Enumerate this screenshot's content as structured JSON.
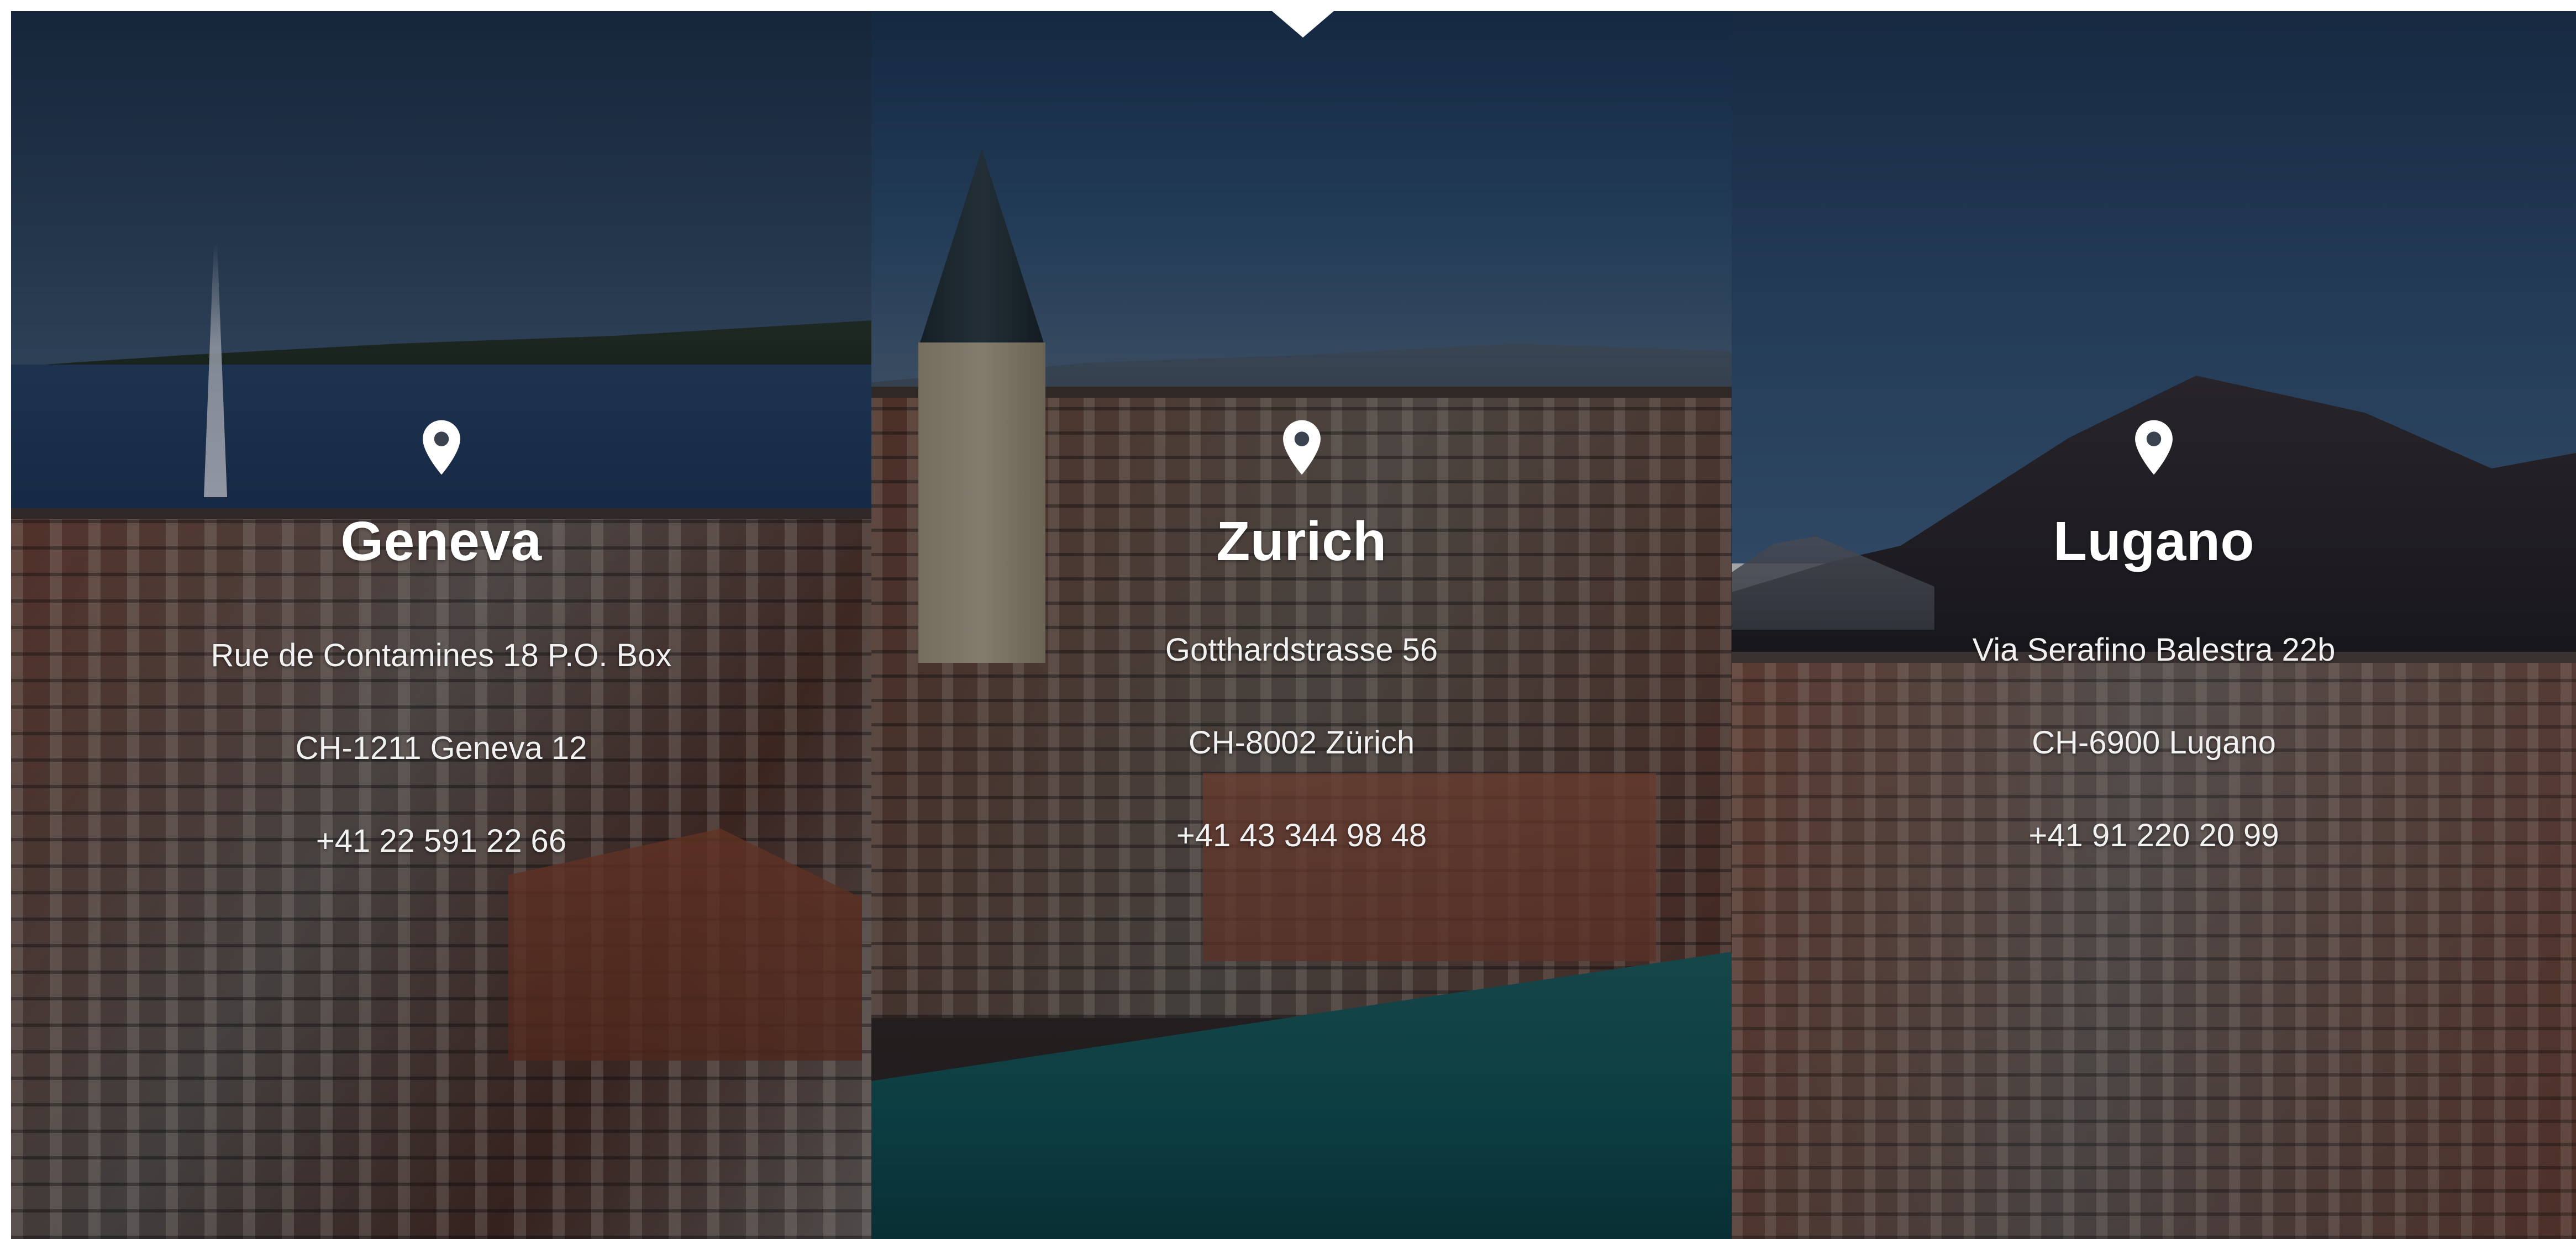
{
  "offices": [
    {
      "city": "Geneva",
      "street": "Rue de Contamines 18 P.O. Box",
      "postal": "CH-1211 Geneva 12",
      "phone": "+41 22 591 22 66",
      "icon": "map-pin-icon"
    },
    {
      "city": "Zurich",
      "street": "Gotthardstrasse 56",
      "postal": "CH-8002 Zürich",
      "phone": "+41 43 344 98 48",
      "icon": "map-pin-icon"
    },
    {
      "city": "Lugano",
      "street": "Via Serafino Balestra 22b",
      "postal": "CH-6900 Lugano",
      "phone": "+41 91 220 20 99",
      "icon": "map-pin-icon"
    }
  ],
  "active_office": "Zurich",
  "colors": {
    "text": "#ffffff",
    "overlay": "#080e18",
    "notch": "#ffffff"
  }
}
